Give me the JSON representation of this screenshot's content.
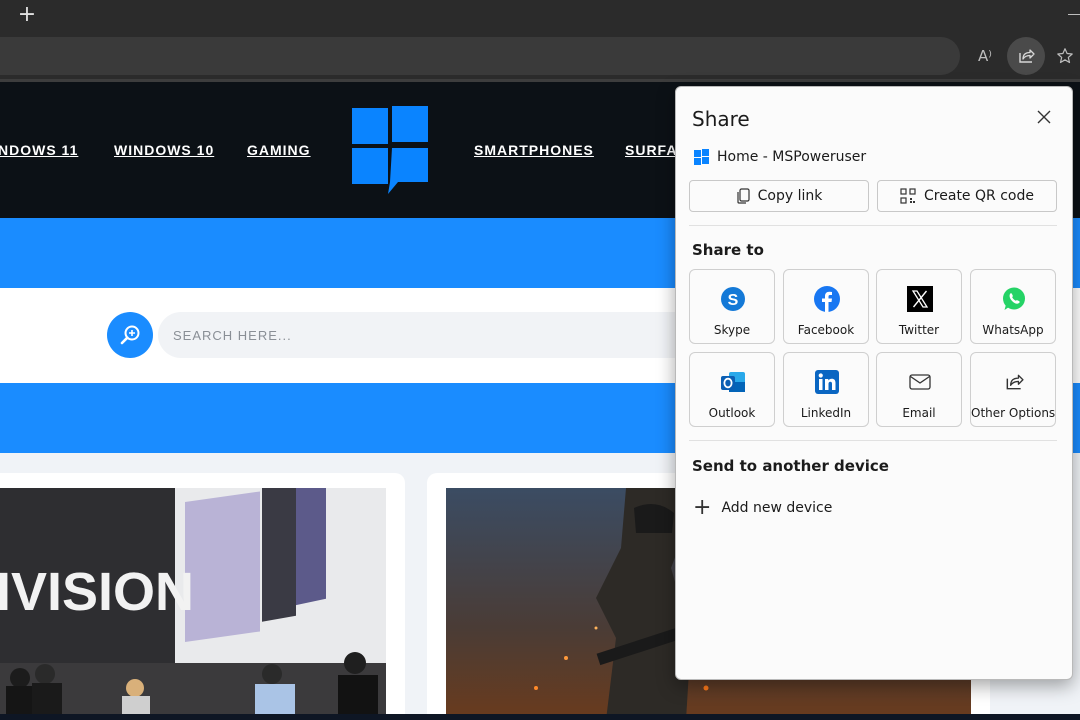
{
  "browser": {
    "new_tab_symbol": "+",
    "read_aloud_symbol": "A⁾",
    "toolbar_icons": [
      "read-aloud-icon",
      "share-icon",
      "favorite-star-icon"
    ]
  },
  "site": {
    "nav": {
      "windows11": "NDOWS 11",
      "windows10": "WINDOWS 10",
      "gaming": "GAMING",
      "smartphones": "SMARTPHONES",
      "surface": "SURFA"
    },
    "search_placeholder": "SEARCH HERE...",
    "card1_image_text": "IVISION",
    "colors": {
      "accent": "#1a8cff",
      "header": "#0c1116"
    }
  },
  "share": {
    "title": "Share",
    "page_title": "Home - MSPoweruser",
    "copy_link": "Copy link",
    "create_qr": "Create QR code",
    "share_to_heading": "Share to",
    "targets": [
      {
        "label": "Skype",
        "icon": "skype-icon"
      },
      {
        "label": "Facebook",
        "icon": "facebook-icon"
      },
      {
        "label": "Twitter",
        "icon": "x-twitter-icon"
      },
      {
        "label": "WhatsApp",
        "icon": "whatsapp-icon"
      },
      {
        "label": "Outlook",
        "icon": "outlook-icon"
      },
      {
        "label": "LinkedIn",
        "icon": "linkedin-icon"
      },
      {
        "label": "Email",
        "icon": "email-icon"
      },
      {
        "label": "Other Options",
        "icon": "share-out-icon"
      }
    ],
    "send_heading": "Send to another device",
    "add_device": "Add new device"
  }
}
